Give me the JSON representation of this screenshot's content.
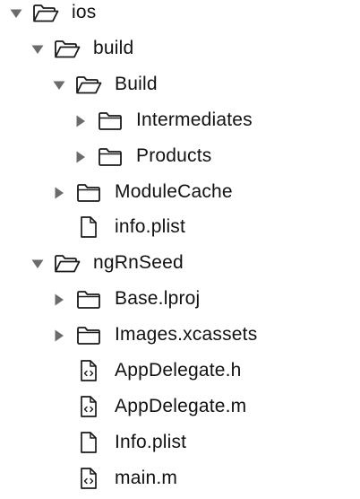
{
  "tree": {
    "nodes": [
      {
        "id": "ios",
        "label": "ios",
        "depth": 0,
        "kind": "folder",
        "expanded": true
      },
      {
        "id": "build",
        "label": "build",
        "depth": 1,
        "kind": "folder",
        "expanded": true
      },
      {
        "id": "build-inner",
        "label": "Build",
        "depth": 2,
        "kind": "folder",
        "expanded": true
      },
      {
        "id": "intermediates",
        "label": "Intermediates",
        "depth": 3,
        "kind": "folder",
        "expanded": false
      },
      {
        "id": "products",
        "label": "Products",
        "depth": 3,
        "kind": "folder",
        "expanded": false
      },
      {
        "id": "modulecache",
        "label": "ModuleCache",
        "depth": 2,
        "kind": "folder",
        "expanded": false
      },
      {
        "id": "info-plist-build",
        "label": "info.plist",
        "depth": 2,
        "kind": "file"
      },
      {
        "id": "ngrnseed",
        "label": "ngRnSeed",
        "depth": 1,
        "kind": "folder",
        "expanded": true
      },
      {
        "id": "base-lproj",
        "label": "Base.lproj",
        "depth": 2,
        "kind": "folder",
        "expanded": false
      },
      {
        "id": "images-xcassets",
        "label": "Images.xcassets",
        "depth": 2,
        "kind": "folder",
        "expanded": false
      },
      {
        "id": "appdelegate-h",
        "label": "AppDelegate.h",
        "depth": 2,
        "kind": "source"
      },
      {
        "id": "appdelegate-m",
        "label": "AppDelegate.m",
        "depth": 2,
        "kind": "source"
      },
      {
        "id": "info-plist-app",
        "label": "Info.plist",
        "depth": 2,
        "kind": "file"
      },
      {
        "id": "main-m",
        "label": "main.m",
        "depth": 2,
        "kind": "source"
      }
    ]
  },
  "icons": {
    "folder_open": "folder-open-icon",
    "folder_closed": "folder-icon",
    "file": "file-icon",
    "source_file": "source-file-icon",
    "expanded": "triangle-down-icon",
    "collapsed": "triangle-right-icon"
  },
  "colors": {
    "background": "#ffffff",
    "text": "#111111",
    "icon_stroke": "#1a1a1a",
    "disclosure": "#6b6b6b"
  }
}
